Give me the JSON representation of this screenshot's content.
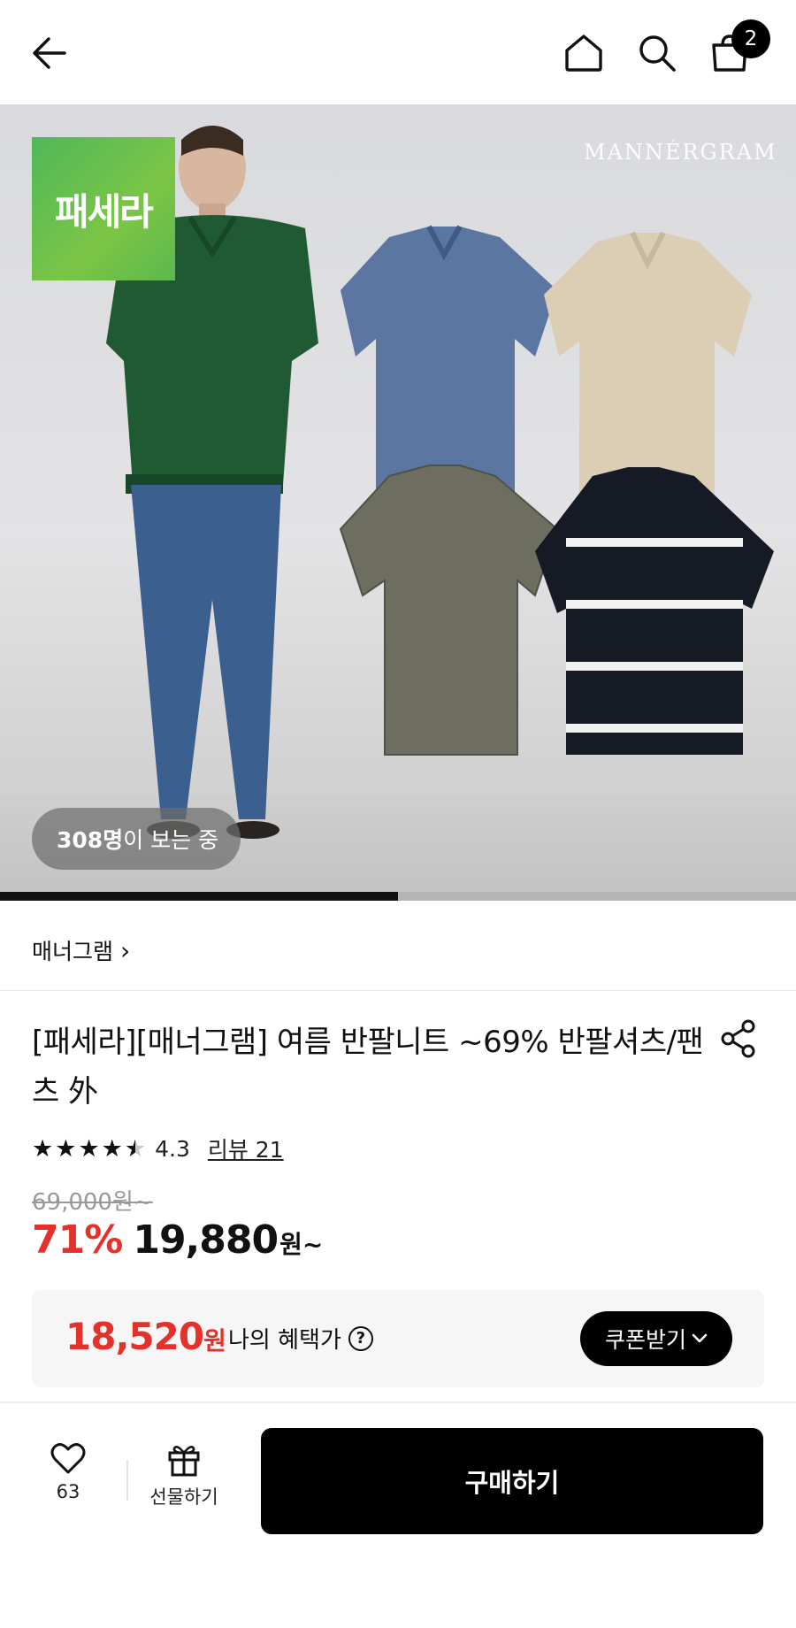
{
  "header": {
    "back_icon": "arrow-left-icon",
    "home_icon": "home-icon",
    "search_icon": "search-icon",
    "cart_icon": "shopping-bag-icon",
    "cart_count": "2"
  },
  "hero": {
    "brand_tag": "패세라",
    "watermark": "MANNÉRGRAM",
    "viewers_count": "308명",
    "viewers_suffix": "이 보는 중",
    "slide_progress": 0.5
  },
  "brand": {
    "name": "매너그램",
    "chevron": "›"
  },
  "product": {
    "title": "[패세라][매너그램] 여름 반팔니트 ~69% 반팔셔츠/팬츠 外",
    "share_icon": "share-icon",
    "rating": 4.3,
    "rating_text": "4.3",
    "review_label": "리뷰 21",
    "original_price": "69,000원~",
    "discount": "71%",
    "sale_price": "19,880",
    "sale_unit": "원~"
  },
  "benefit": {
    "amount": "18,520",
    "unit": "원",
    "label": "나의 혜택가",
    "help": "?",
    "coupon_button": "쿠폰받기"
  },
  "bottom_bar": {
    "like_count": "63",
    "gift_label": "선물하기",
    "buy_label": "구매하기"
  },
  "colors": {
    "accent_red": "#e4312b",
    "brand_green": "#5db84e",
    "black": "#000000"
  }
}
